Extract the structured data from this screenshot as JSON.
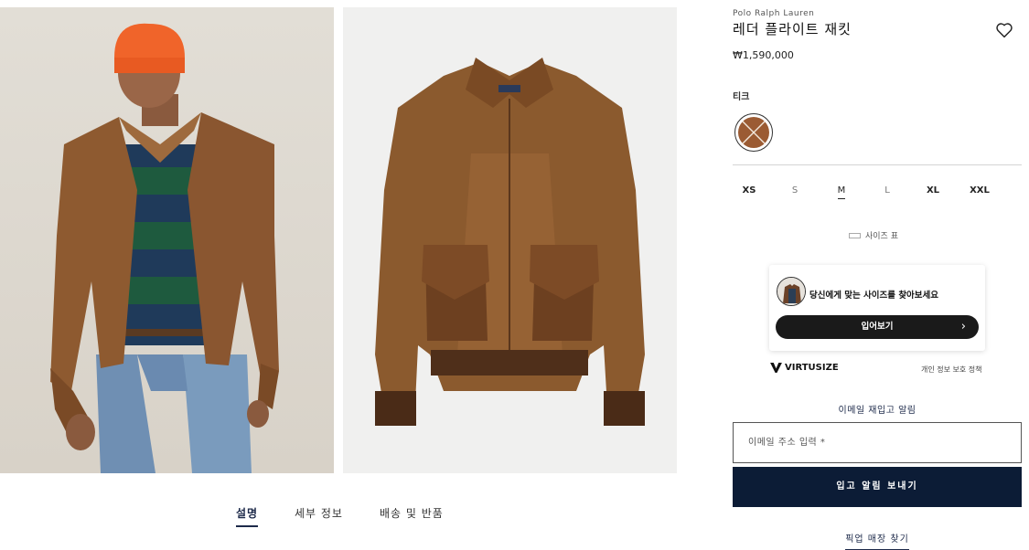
{
  "product": {
    "brand": "Polo Ralph Lauren",
    "title": "레더 플라이트 재킷",
    "price": "₩1,590,000"
  },
  "color": {
    "label": "티크",
    "swatch_color": "#9b5b33"
  },
  "sizes": [
    {
      "label": "XS",
      "state": "available"
    },
    {
      "label": "S",
      "state": "unavailable"
    },
    {
      "label": "M",
      "state": "selected"
    },
    {
      "label": "L",
      "state": "unavailable"
    },
    {
      "label": "XL",
      "state": "available"
    },
    {
      "label": "XXL",
      "state": "available"
    }
  ],
  "size_chart_label": "사이즈 표",
  "virtusize": {
    "prompt": "당신에게 맞는 사이즈를 찾아보세요",
    "button_label": "입어보기",
    "brand": "VIRTUSIZE",
    "privacy_label": "개인 정보 보호 정책"
  },
  "restock": {
    "label": "이메일 재입고 알림",
    "email_placeholder": "이메일 주소 입력 *",
    "submit_label": "입고 알림 보내기"
  },
  "store_link_label": "픽업 매장 찾기",
  "tabs": [
    {
      "label": "설명",
      "active": true
    },
    {
      "label": "세부 정보",
      "active": false
    },
    {
      "label": "배송 및 반품",
      "active": false
    }
  ],
  "colors": {
    "navy": "#0c1c36",
    "leather": "#9b5b33"
  }
}
